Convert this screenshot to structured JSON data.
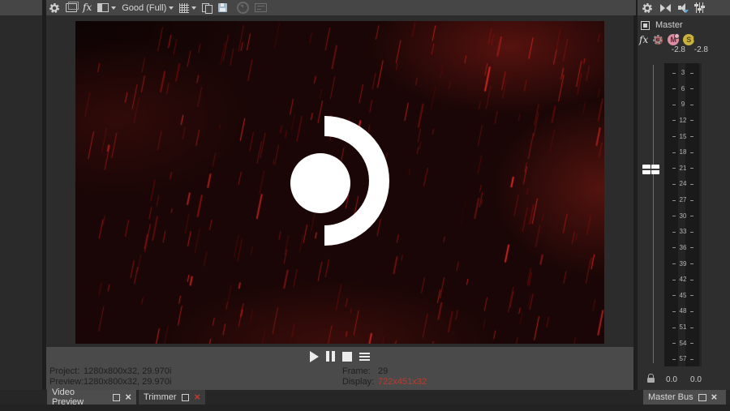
{
  "glyphs": {
    "close": "×"
  },
  "preview_window": {
    "toolbar": {
      "fx_label": "fx",
      "quality_label": "Good (Full)",
      "icons": [
        "project-properties-gear",
        "preview-device",
        "video-output-fx",
        "split-screen-view",
        "preview-quality",
        "grid-overlay",
        "copy-snapshot",
        "save-snapshot",
        "external-device",
        "hdr-monitor"
      ]
    },
    "transport_icons": [
      "play",
      "pause",
      "stop",
      "menu"
    ],
    "status": {
      "project_label": "Project:",
      "project_value": "1280x800x32, 29.970i",
      "preview_label": "Preview:",
      "preview_value": "1280x800x32, 29.970i",
      "frame_label": "Frame:",
      "frame_value": "29",
      "display_label": "Display:",
      "display_value": "722x451x32"
    },
    "tabs": [
      {
        "label": "Video Preview",
        "active": true
      },
      {
        "label": "Trimmer",
        "active": false
      }
    ]
  },
  "mixer": {
    "toolbar_icons": [
      "settings-gear",
      "downmix-output",
      "dim-output",
      "mixer-controls"
    ],
    "bus_label": "Master",
    "fx_label": "fx",
    "mute_label": "M",
    "solo_label": "S",
    "automation_badge": "R",
    "peaks": [
      "-2.8",
      "-2.8"
    ],
    "scale_labels": [
      "3",
      "6",
      "9",
      "12",
      "15",
      "18",
      "21",
      "24",
      "27",
      "30",
      "33",
      "36",
      "39",
      "42",
      "45",
      "48",
      "51",
      "54",
      "57"
    ],
    "faders": [
      "0.0",
      "0.0"
    ],
    "tab_label": "Master Bus"
  },
  "colors": {
    "display_value_red": "#bf3a2b",
    "trimmer_close_red": "#c23b2e",
    "rain_bright": "#ff5040",
    "rain_dim": "#5a1410",
    "accent_blue": "#5aa7d8"
  },
  "rain": {
    "count": 260,
    "seed": 9,
    "angle_lean": 0.2
  }
}
